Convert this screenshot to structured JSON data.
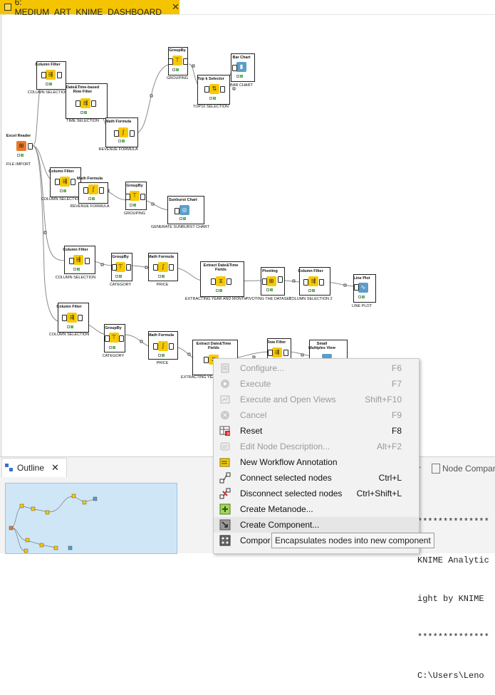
{
  "tab": {
    "title": "6: MEDIUM_ART_KNIME_DASHBOARD",
    "close": "✕"
  },
  "nodes": [
    {
      "id": "excel",
      "label": "Excel Reader",
      "caption": "FILE IMPORT",
      "color": "orange",
      "glyph": "⊞"
    },
    {
      "id": "cf1",
      "label": "Column Filter",
      "caption": "COLUMN SELECTION",
      "color": "yellow",
      "glyph": "⇶"
    },
    {
      "id": "dtf",
      "label": "Date&Time-based Row Filter",
      "caption": "TIME SELECTION",
      "color": "yellow",
      "glyph": "⇶"
    },
    {
      "id": "mf1",
      "label": "Math Formula",
      "caption": "REVENUE FORMULA",
      "color": "yellow",
      "glyph": "∫"
    },
    {
      "id": "gb1",
      "label": "GroupBy",
      "caption": "GROUPING",
      "color": "yellow",
      "glyph": "⊤"
    },
    {
      "id": "topk",
      "label": "Top k Selector",
      "caption": "TOP10 SELECTION",
      "color": "yellow",
      "glyph": "⇅"
    },
    {
      "id": "bar",
      "label": "Bar Chart",
      "caption": "BAR CHART",
      "color": "blue",
      "glyph": "▮"
    },
    {
      "id": "cf2",
      "label": "Column Filter",
      "caption": "COLUMN SELECTION",
      "color": "yellow",
      "glyph": "⇶"
    },
    {
      "id": "mf2",
      "label": "Math Formula",
      "caption": "REVENUE FORMULA",
      "color": "yellow",
      "glyph": "∫"
    },
    {
      "id": "gb2",
      "label": "GroupBy",
      "caption": "GROUPING",
      "color": "yellow",
      "glyph": "⊤"
    },
    {
      "id": "sun",
      "label": "Sunburst Chart",
      "caption": "GENERATE SUNBURST CHART",
      "color": "blue",
      "glyph": "◎"
    },
    {
      "id": "cf3",
      "label": "Column Filter",
      "caption": "COLUMN SELECTION",
      "color": "yellow",
      "glyph": "⇶"
    },
    {
      "id": "gb3",
      "label": "GroupBy",
      "caption": "CATEGORY",
      "color": "yellow",
      "glyph": "⊤"
    },
    {
      "id": "mf3",
      "label": "Math Formula",
      "caption": "PRICE",
      "color": "yellow",
      "glyph": "∫"
    },
    {
      "id": "edt1",
      "label": "Extract Date&Time Fields",
      "caption": "EXTRACTING YEAR AND MONTH",
      "color": "yellow",
      "glyph": "⧖"
    },
    {
      "id": "piv",
      "label": "Pivoting",
      "caption": "PIVOTING THE DATASET",
      "color": "yellow",
      "glyph": "⊞"
    },
    {
      "id": "cf4",
      "label": "Column Filter",
      "caption": "COLUMN SELECTION 2",
      "color": "yellow",
      "glyph": "⇶"
    },
    {
      "id": "line",
      "label": "Line Plot",
      "caption": "LINE PLOT",
      "color": "blue",
      "glyph": "∿"
    },
    {
      "id": "cf5",
      "label": "Column Filter",
      "caption": "COLUMN SELECTION",
      "color": "yellow",
      "glyph": "⇶"
    },
    {
      "id": "gb4",
      "label": "GroupBy",
      "caption": "CATEGORY",
      "color": "yellow",
      "glyph": "⊤"
    },
    {
      "id": "mf4",
      "label": "Math Formula",
      "caption": "PRICE",
      "color": "yellow",
      "glyph": "∫"
    },
    {
      "id": "edt2",
      "label": "Extract Date&Time Fields",
      "caption": "EXTRACTING YEA",
      "color": "yellow",
      "glyph": "⧖"
    },
    {
      "id": "rowf",
      "label": "Row Filter",
      "caption": "",
      "color": "yellow",
      "glyph": "⇶"
    },
    {
      "id": "smv",
      "label": "Small Multiples View",
      "caption": "",
      "color": "blue",
      "glyph": "▦"
    }
  ],
  "context_menu": [
    {
      "label": "Configure...",
      "shortcut": "F6",
      "enabled": false,
      "icon": "configure-icon"
    },
    {
      "label": "Execute",
      "shortcut": "F7",
      "enabled": false,
      "icon": "execute-icon"
    },
    {
      "label": "Execute and Open Views",
      "shortcut": "Shift+F10",
      "enabled": false,
      "icon": "execute-open-views-icon"
    },
    {
      "label": "Cancel",
      "shortcut": "F9",
      "enabled": false,
      "icon": "cancel-icon"
    },
    {
      "label": "Reset",
      "shortcut": "F8",
      "enabled": true,
      "icon": "reset-icon"
    },
    {
      "label": "Edit Node Description...",
      "shortcut": "Alt+F2",
      "enabled": false,
      "icon": "edit-description-icon"
    },
    {
      "label": "New Workflow Annotation",
      "shortcut": "",
      "enabled": true,
      "icon": "annotation-icon"
    },
    {
      "label": "Connect selected nodes",
      "shortcut": "Ctrl+L",
      "enabled": true,
      "icon": "connect-icon"
    },
    {
      "label": "Disconnect selected nodes",
      "shortcut": "Ctrl+Shift+L",
      "enabled": true,
      "icon": "disconnect-icon"
    },
    {
      "label": "Create Metanode...",
      "shortcut": "",
      "enabled": true,
      "icon": "metanode-icon"
    },
    {
      "label": "Create Component...",
      "shortcut": "",
      "enabled": true,
      "icon": "component-icon"
    },
    {
      "label": "Compor",
      "shortcut": "",
      "enabled": true,
      "icon": "component-submenu-icon"
    }
  ],
  "tooltip": "Encapsulates nodes into new component",
  "outline_tab": {
    "label": "Outline",
    "close": "✕"
  },
  "right_tabs": {
    "first": "r",
    "second": "Node Compar"
  },
  "console_lines": [
    "**************",
    "KNIME Analytic",
    "ight by KNIME",
    "**************",
    "C:\\Users\\Leno"
  ],
  "colors": {
    "knime_yellow": "#f7c900",
    "tab_yellow": "#f5c400",
    "view_blue": "#5b9ec9",
    "reader_orange": "#e8782a"
  }
}
